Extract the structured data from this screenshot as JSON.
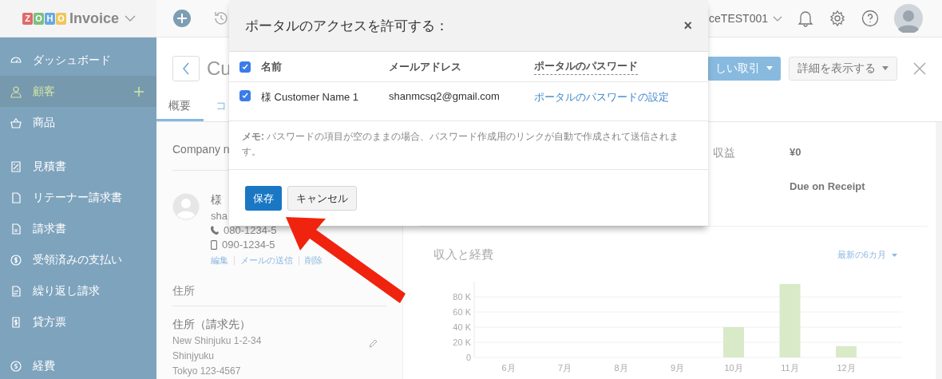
{
  "topbar": {
    "logo_letters": [
      {
        "letter": "Z",
        "color": "#e06b6b"
      },
      {
        "letter": "O",
        "color": "#7cc07c"
      },
      {
        "letter": "H",
        "color": "#6aa9e0"
      },
      {
        "letter": "O",
        "color": "#f0c65a"
      }
    ],
    "logo_text": "Invoice",
    "org_name": "ceTEST001"
  },
  "sidebar": {
    "sections": [
      [
        {
          "label": "ダッシュボード",
          "selected": false
        },
        {
          "label": "顧客",
          "selected": true
        },
        {
          "label": "商品",
          "selected": false
        }
      ],
      [
        {
          "label": "見積書",
          "selected": false
        },
        {
          "label": "リテーナー請求書",
          "selected": false
        },
        {
          "label": "請求書",
          "selected": false
        },
        {
          "label": "受領済みの支払い",
          "selected": false
        },
        {
          "label": "繰り返し請求",
          "selected": false
        },
        {
          "label": "貸方票",
          "selected": false
        }
      ],
      [
        {
          "label": "経費",
          "selected": false
        }
      ]
    ]
  },
  "header": {
    "title": "Cu",
    "new_transaction": "しい取引",
    "details": "詳細を表示する"
  },
  "tabs": [
    {
      "label": "概要",
      "selected": true
    },
    {
      "label": "コ",
      "selected": false
    }
  ],
  "contact": {
    "company_label": "Company n",
    "name": "様",
    "email": "sha",
    "phone": "080-1234-5",
    "mobile": "090-1234-5",
    "actions": [
      "編集",
      "メールの送信",
      "削除"
    ]
  },
  "address": {
    "section": "住所",
    "billing_title": "住所（請求先）",
    "lines": [
      "New Shinjuku 1-2-34",
      "Shinjyuku",
      "Tokyo 123-4567"
    ]
  },
  "summary": [
    {
      "label": "収益",
      "value": "¥0"
    },
    {
      "value": "Due on Receipt"
    }
  ],
  "income_chart": {
    "title": "収入と経費",
    "period": "最新の6カ月",
    "chart_data": {
      "type": "bar",
      "categories": [
        "6月",
        "7月",
        "8月",
        "9月",
        "10月",
        "11月",
        "12月"
      ],
      "series": [
        {
          "color": "#d9eac8",
          "values": [
            0,
            0,
            0,
            0,
            40000,
            97000,
            15000
          ]
        }
      ],
      "grid": true,
      "ylim": [
        0,
        100000
      ],
      "yticks": [
        {
          "value": 0,
          "label": "0"
        },
        {
          "value": 20000,
          "label": "20 K"
        },
        {
          "value": 40000,
          "label": "40 K"
        },
        {
          "value": 60000,
          "label": "60 K"
        },
        {
          "value": 80000,
          "label": "80 K"
        }
      ]
    }
  },
  "dialog": {
    "title": "ポータルのアクセスを許可する：",
    "close": "×",
    "select_all_checked": true,
    "columns": [
      "名前",
      "メールアドレス",
      "ポータルのパスワード"
    ],
    "rows": [
      {
        "checked": true,
        "name": "様 Customer Name 1",
        "email": "shanmcsq2@gmail.com",
        "password_link": "ポータルのパスワードの設定"
      }
    ],
    "note": "**メモ:** パスワードの項目が空のままの場合、パスワード作成用のリンクが自動で作成されて送信されます。",
    "buttons": [
      {
        "label": "保存",
        "kind": "primary"
      },
      {
        "label": "キャンセル",
        "kind": "secondary"
      }
    ]
  }
}
